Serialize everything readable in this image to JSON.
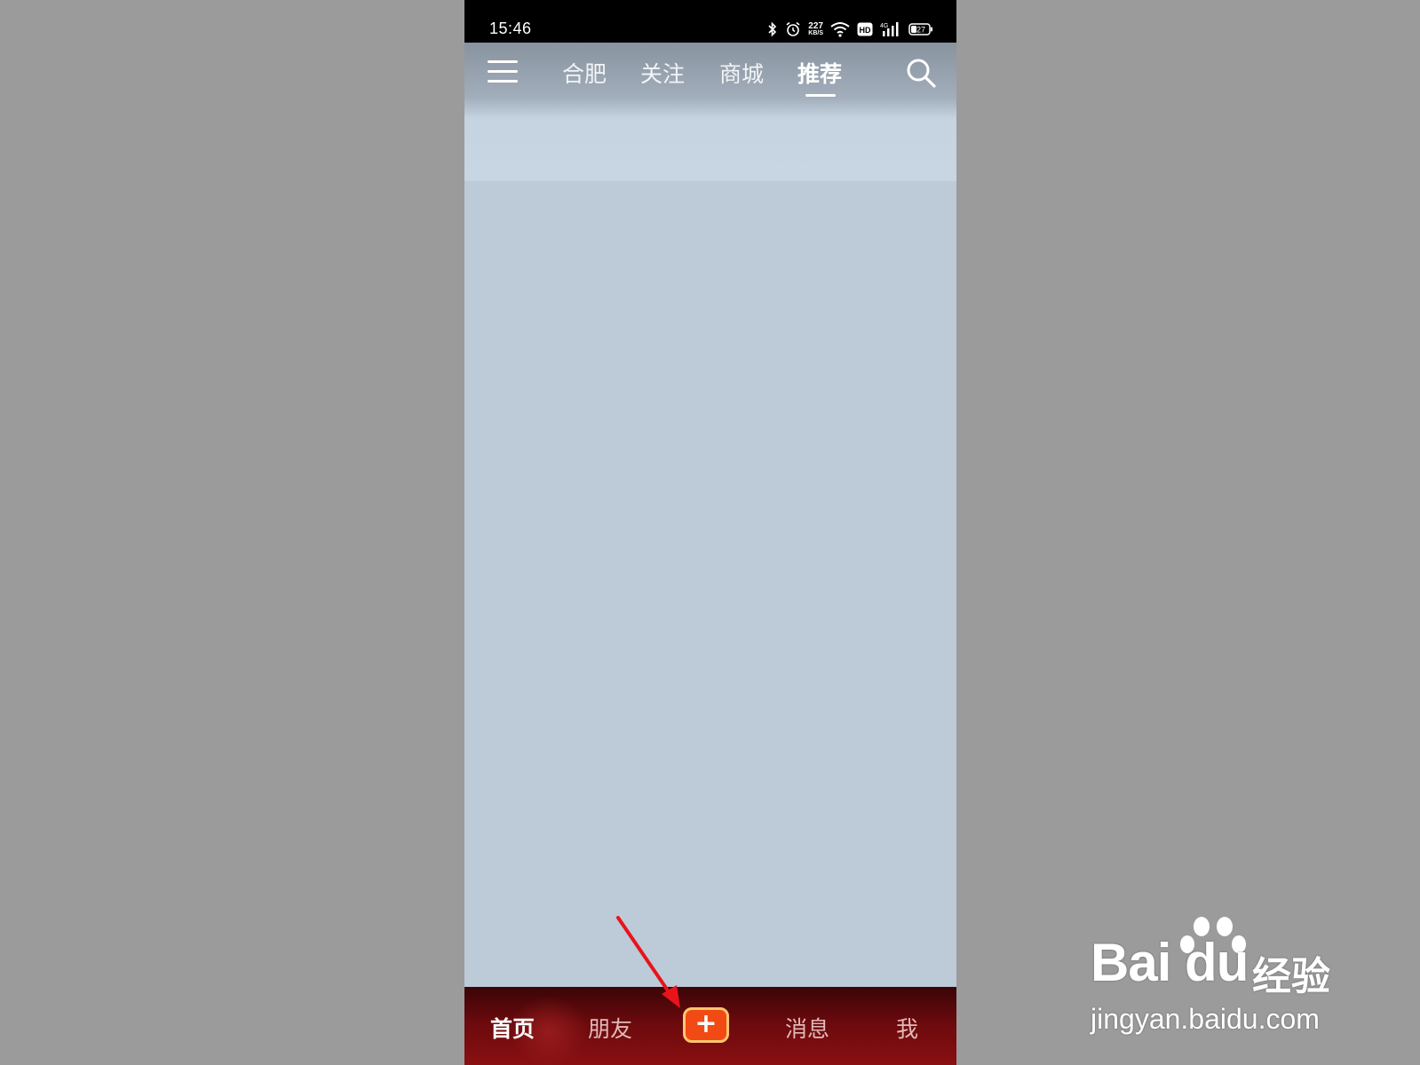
{
  "status_bar": {
    "time": "15:46",
    "net_speed": "227",
    "net_speed_unit": "KB/S",
    "hd_label": "HD",
    "network_type": "4G",
    "battery": "27",
    "icons": [
      "bluetooth-icon",
      "alarm-icon",
      "wifi-icon",
      "hd-icon",
      "signal-icon",
      "battery-icon"
    ]
  },
  "header": {
    "tabs": [
      {
        "label": "合肥",
        "active": false
      },
      {
        "label": "关注",
        "active": false
      },
      {
        "label": "商城",
        "active": false
      },
      {
        "label": "推荐",
        "active": true
      }
    ],
    "icons": [
      "menu-icon",
      "search-icon"
    ]
  },
  "bottom_nav": {
    "items": [
      {
        "label": "首页",
        "active": true
      },
      {
        "label": "朋友",
        "active": false
      },
      {
        "label": "+",
        "type": "publish"
      },
      {
        "label": "消息",
        "active": false
      },
      {
        "label": "我",
        "active": false
      }
    ]
  },
  "watermark": {
    "logo_text": "Bai du",
    "brand_suffix": "经验",
    "url": "jingyan.baidu.com"
  },
  "colors": {
    "page_bg": "#9b9b9b",
    "content_bg": "#bdcad8",
    "nav_bg": "#6a0a0d",
    "publish_btn": "#f24a14",
    "publish_border": "#ffc66e",
    "annotation_arrow": "#e8141a"
  }
}
